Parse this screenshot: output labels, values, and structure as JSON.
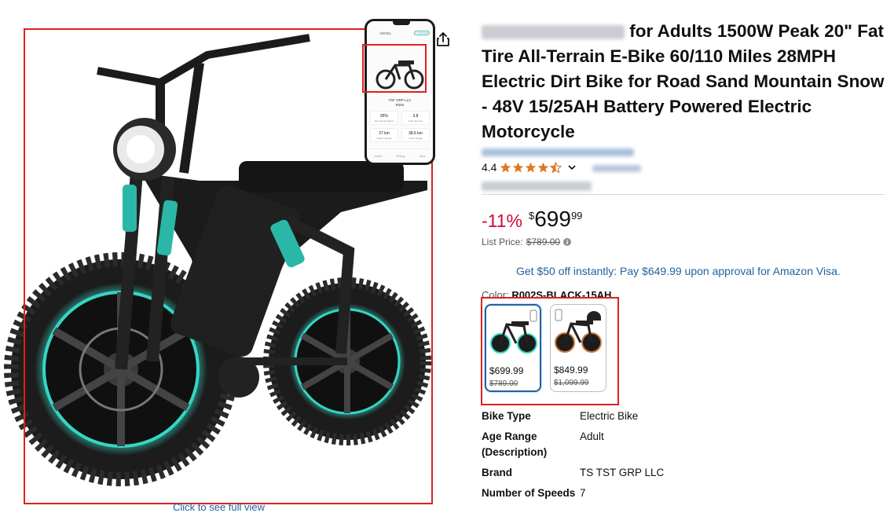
{
  "gallery": {
    "full_view_link": "Click to see full view",
    "phone_screen": {
      "brand": "ANGEL",
      "status": "Connected",
      "company": "TSF GRP LLC",
      "model": "R002",
      "tiles": [
        {
          "value": "95%",
          "label": "Remaining battery"
        },
        {
          "value": "3.8",
          "label": "Total ride time"
        },
        {
          "value": "27 km",
          "label": "Single mileage"
        },
        {
          "value": "38.6 km",
          "label": "Total mileage"
        }
      ],
      "nav": [
        "Home",
        "Riding",
        "Mine"
      ]
    }
  },
  "product": {
    "title_visible": "for Adults 1500W Peak 20\" Fat Tire All-Terrain E-Bike 60/110 Miles 28MPH Electric Dirt Bike for Road Sand Mountain Snow - 48V 15/25AH Battery Powered Electric Motorcycle",
    "rating": "4.4",
    "stars_filled": 4.4,
    "price": {
      "discount": "-11%",
      "symbol": "$",
      "whole": "699",
      "fraction": "99"
    },
    "list_price": {
      "label": "List Price:",
      "value": "$789.00"
    },
    "promo": "Get $50 off instantly: Pay $649.99 upon approval for Amazon Visa.",
    "color": {
      "label": "Color:",
      "value": "R002S-BLACK-15AH"
    },
    "swatches": [
      {
        "price": "$699.99",
        "list_price": "$789.00",
        "selected": true
      },
      {
        "price": "$849.99",
        "list_price": "$1,099.99",
        "selected": false
      }
    ],
    "specs": [
      {
        "key": "Bike Type",
        "value": "Electric Bike"
      },
      {
        "key": "Age Range (Description)",
        "value": "Adult"
      },
      {
        "key": "Brand",
        "value": "TS TST GRP LLC"
      },
      {
        "key": "Number of Speeds",
        "value": "7"
      }
    ]
  },
  "colors": {
    "accent_teal": "#35d6c4",
    "link_blue": "#2162a1",
    "discount_red": "#cc0c39",
    "star_orange": "#de7921",
    "highlight_red": "#e02020"
  }
}
